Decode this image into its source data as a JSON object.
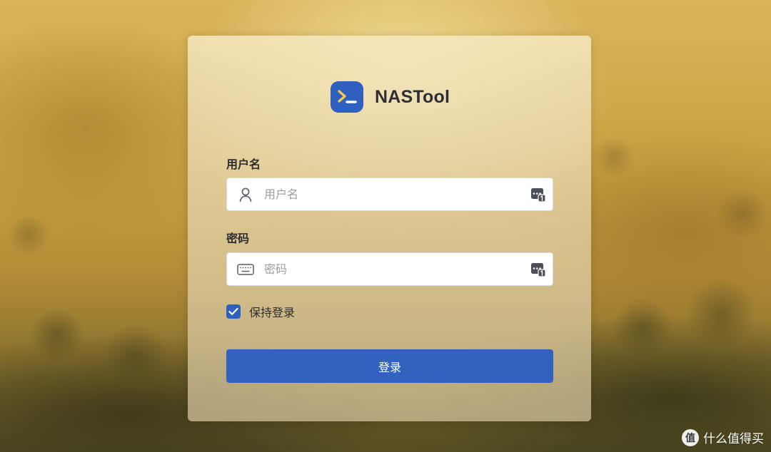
{
  "app": {
    "name": "NASTool",
    "brand_color": "#2f5fbf"
  },
  "login_form": {
    "username": {
      "label": "用户名",
      "placeholder": "用户名",
      "value": "",
      "icon": "user-icon"
    },
    "password": {
      "label": "密码",
      "placeholder": "密码",
      "value": "",
      "icon": "keyboard-icon"
    },
    "remember": {
      "label": "保持登录",
      "checked": true
    },
    "submit_label": "登录",
    "password_manager_icon": "password-manager-icon"
  },
  "watermark": {
    "text": "什么值得买",
    "icon": "zhi-logo-icon",
    "icon_glyph": "值"
  }
}
